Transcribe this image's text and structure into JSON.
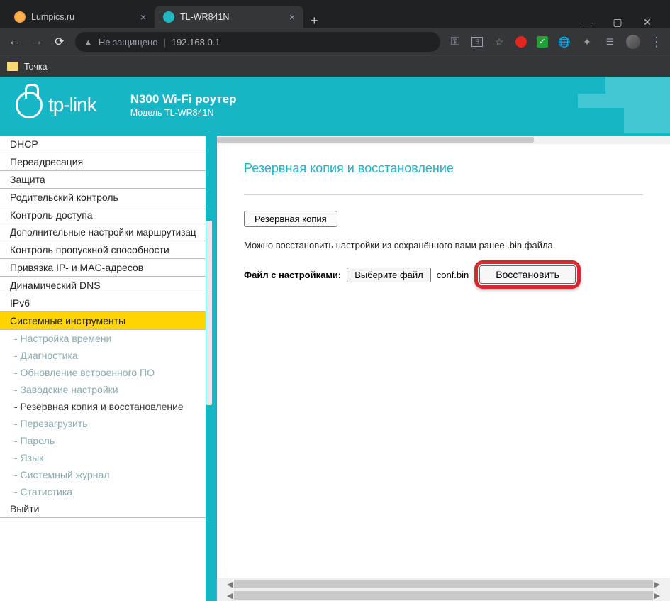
{
  "browser": {
    "tabs": [
      {
        "title": "Lumpics.ru",
        "active": false
      },
      {
        "title": "TL-WR841N",
        "active": true
      }
    ],
    "omnibox": {
      "security_label": "Не защищено",
      "url": "192.168.0.1"
    },
    "bookmark": "Точка"
  },
  "header": {
    "brand": "tp-link",
    "line1": "N300 Wi-Fi роутер",
    "line2": "Модель TL-WR841N"
  },
  "sidebar": {
    "items": [
      "DHCP",
      "Переадресация",
      "Защита",
      "Родительский контроль",
      "Контроль доступа",
      "Дополнительные настройки маршрутизац",
      "Контроль пропускной способности",
      "Привязка IP- и MAC-адресов",
      "Динамический DNS",
      "IPv6",
      "Системные инструменты"
    ],
    "subitems": [
      "- Настройка времени",
      "- Диагностика",
      "- Обновление встроенного ПО",
      "- Заводские настройки",
      "- Резервная копия и восстановление",
      "- Перезагрузить",
      "- Пароль",
      "- Язык",
      "- Системный журнал",
      "- Статистика"
    ],
    "logout": "Выйти",
    "active_index": 10,
    "current_sub_index": 4
  },
  "content": {
    "title": "Резервная копия и восстановление",
    "backup_button": "Резервная копия",
    "description": "Можно восстановить настройки из сохранённого вами ранее .bin файла.",
    "file_label": "Файл с настройками:",
    "choose_button": "Выберите файл",
    "file_name": "conf.bin",
    "restore_button": "Восстановить"
  }
}
